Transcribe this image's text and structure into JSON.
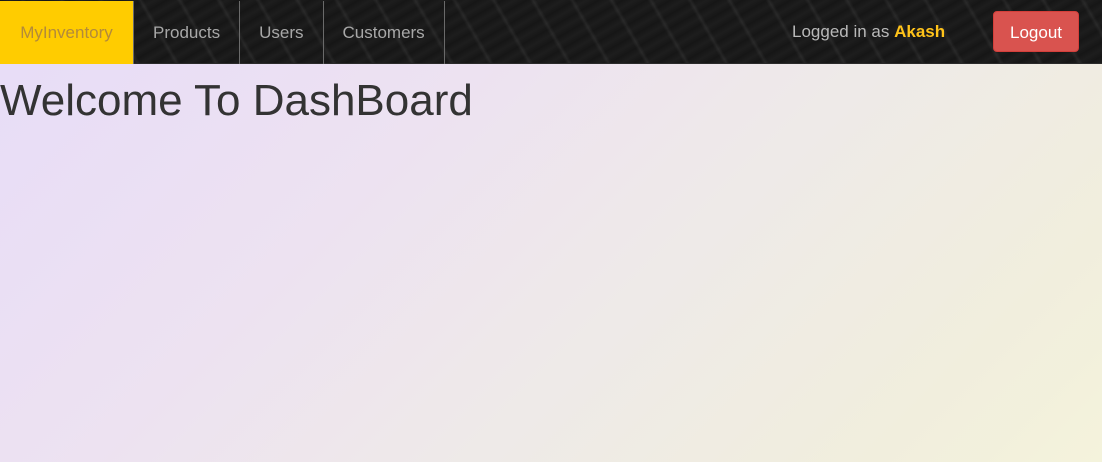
{
  "navbar": {
    "brand": "MyInventory",
    "items": [
      {
        "label": "Products"
      },
      {
        "label": "Users"
      },
      {
        "label": "Customers"
      }
    ],
    "logged_in_prefix": "Logged in as",
    "user_name": "Akash",
    "logout_label": "Logout"
  },
  "main": {
    "title": "Welcome To DashBoard"
  },
  "colors": {
    "brand_bg": "#ffcc00",
    "user_name": "#ffc31a",
    "logout_bg": "#d9534f",
    "navbar_bg": "#1d1d1d"
  }
}
